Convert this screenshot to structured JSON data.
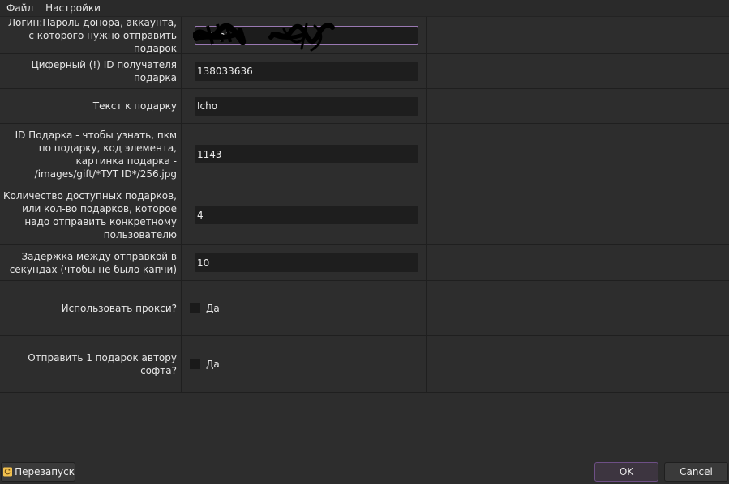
{
  "menu": [
    "Файл",
    "Настройки"
  ],
  "fields": [
    {
      "label": "Логин:Пароль донора, аккаунта, с которого нужно отправить подарок",
      "value": "548:p1"
    },
    {
      "label": "Циферный (!) ID получателя подарка",
      "value": "138033636"
    },
    {
      "label": "Текст к подарку",
      "value": "Icho"
    },
    {
      "label": "ID Подарка - чтобы узнать, пкм по подарку, код элемента, картинка подарка - /images/gift/*ТУТ ID*/256.jpg",
      "value": "1143"
    },
    {
      "label": "Количество доступных подарков, или кол-во подарков, которое надо отправить конкретному пользователю",
      "value": "4"
    },
    {
      "label": "Задержка между отправкой в секундах (чтобы не было капчи)",
      "value": "10"
    }
  ],
  "checkboxes": [
    {
      "label": "Использовать прокси?",
      "option": "Да",
      "checked": false
    },
    {
      "label": "Отправить 1 подарок автору софта?",
      "option": "Да",
      "checked": false
    }
  ],
  "buttons": {
    "restart": "Перезапуск",
    "ok": "OK",
    "cancel": "Cancel"
  },
  "icons": {
    "restart": "restart-icon"
  },
  "colors": {
    "background": "#2d2d2d",
    "input_bg": "#1e1e1e",
    "focus_border": "#9a79b3",
    "ok_border": "#6e4f86"
  }
}
